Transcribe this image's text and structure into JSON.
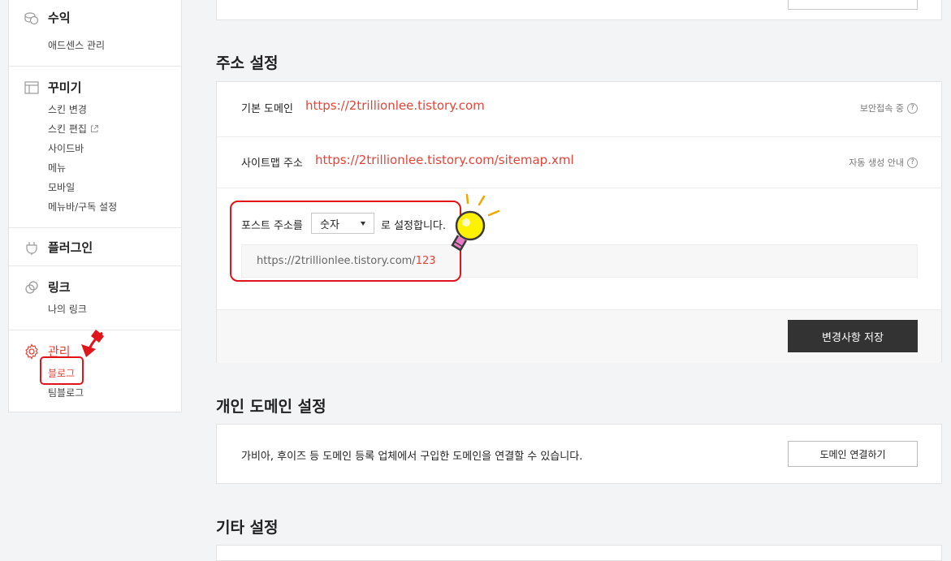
{
  "sidebar": {
    "revenue": {
      "title": "수익",
      "icon": "coins-icon",
      "items": [
        "애드센스 관리"
      ]
    },
    "decorate": {
      "title": "꾸미기",
      "icon": "layout-icon",
      "items": [
        "스킨 변경",
        "스킨 편집",
        "사이드바",
        "메뉴",
        "모바일",
        "메뉴바/구독 설정"
      ]
    },
    "plugin": {
      "title": "플러그인",
      "icon": "plug-icon"
    },
    "link": {
      "title": "링크",
      "icon": "link-icon",
      "items": [
        "나의 링크"
      ]
    },
    "manage": {
      "title": "관리",
      "icon": "gear-icon",
      "items": [
        "블로그",
        "팀블로그"
      ]
    }
  },
  "address": {
    "section_title": "주소 설정",
    "basic_domain_label": "기본 도메인",
    "basic_domain_url": "https://2trillionlee.tistory.com",
    "secure_label": "보안접속 중",
    "sitemap_label": "사이트맵 주소",
    "sitemap_url": "https://2trillionlee.tistory.com/sitemap.xml",
    "auto_label": "자동 생성 안내",
    "post_prefix": "포스트 주소를",
    "post_select": "숫자",
    "post_suffix": "로 설정합니다.",
    "preview_base": "https://2trillionlee.tistory.com/",
    "preview_num": "123",
    "save_button": "변경사항 저장"
  },
  "personal_domain": {
    "section_title": "개인 도메인 설정",
    "description": "가비아, 후이즈 등 도메인 등록 업체에서 구입한 도메인을 연결할 수 있습니다.",
    "connect_button": "도메인 연결하기"
  },
  "other": {
    "section_title": "기타 설정"
  },
  "colors": {
    "accent": "#e64338",
    "annotation": "#e0141b",
    "dark_button": "#333333"
  }
}
